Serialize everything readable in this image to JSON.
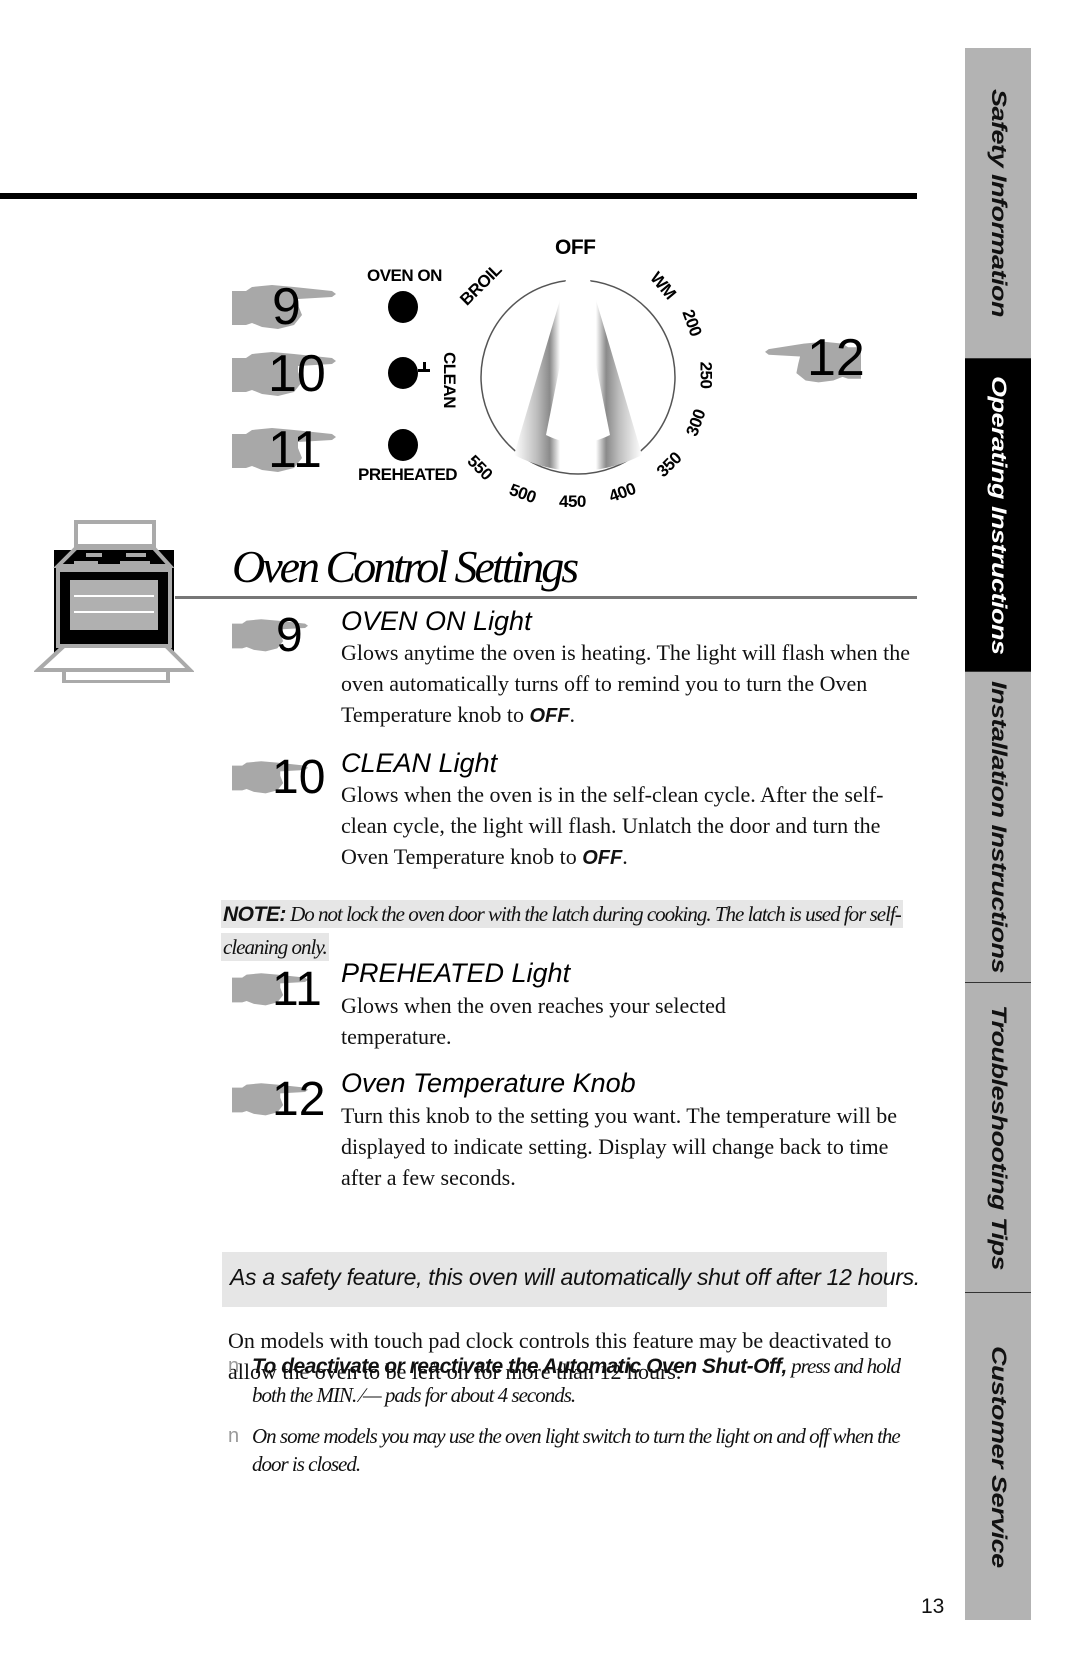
{
  "side_tabs": [
    {
      "label": "Safety Information",
      "active": false
    },
    {
      "label": "Operating Instructions",
      "active": true
    },
    {
      "label": "Installation Instructions",
      "active": false
    },
    {
      "label": "Troubleshooting Tips",
      "active": false
    },
    {
      "label": "Customer Service",
      "active": false
    }
  ],
  "diagram": {
    "callouts": [
      "9",
      "10",
      "11",
      "12"
    ],
    "indicator_labels": {
      "oven_on": "OVEN ON",
      "clean": "CLEAN",
      "preheated": "PREHEATED"
    },
    "knob_labels": {
      "off": "OFF",
      "broil": "BROIL",
      "wm": "WM",
      "t200": "200",
      "t250": "250",
      "t300": "300",
      "t350": "350",
      "t400": "400",
      "t450": "450",
      "t500": "500",
      "t550": "550"
    },
    "knob_setting": "OFF"
  },
  "title": "Oven Control Settings",
  "items": [
    {
      "number": "9",
      "heading": "OVEN ON Light",
      "body": "Glows anytime the oven is heating. The light will flash when the oven automatically turns off to remind you to turn the Oven Temperature knob to ",
      "emph": "OFF",
      "tail": "."
    },
    {
      "number": "10",
      "heading": "CLEAN Light",
      "body": "Glows when the oven is in the self-clean cycle. After the self-clean cycle, the light will flash. Unlatch the door and turn the Oven Temperature knob to ",
      "emph": "OFF",
      "tail": "."
    },
    {
      "number": "11",
      "heading": "PREHEATED Light",
      "body": "Glows when the oven reaches your selected temperature."
    },
    {
      "number": "12",
      "heading": "Oven Temperature Knob",
      "body": "Turn this knob to the setting you want. The temperature will be displayed to indicate setting. Display will change back to time after a few seconds."
    }
  ],
  "note": {
    "label": "NOTE:",
    "text": " Do not lock the oven door with the latch during cooking. The latch is used for self-cleaning only."
  },
  "safety_callout": "As a safety feature, this oven will automatically shut off after 12 hours.",
  "paragraph": "On models with touch pad clock controls this feature may be deactivated to allow the oven to be left on for more than 12 hours.",
  "bullets": [
    {
      "marker": "n",
      "bold": "To deactivate or reactivate the Automatic Oven Shut-Off,",
      "text": " press and hold both the MIN.  ∕— pads for about 4 seconds."
    },
    {
      "marker": "n",
      "bold": "",
      "text": "On some models you may use the oven light switch to turn the light on and off when the door is closed."
    }
  ],
  "page_number": "13"
}
